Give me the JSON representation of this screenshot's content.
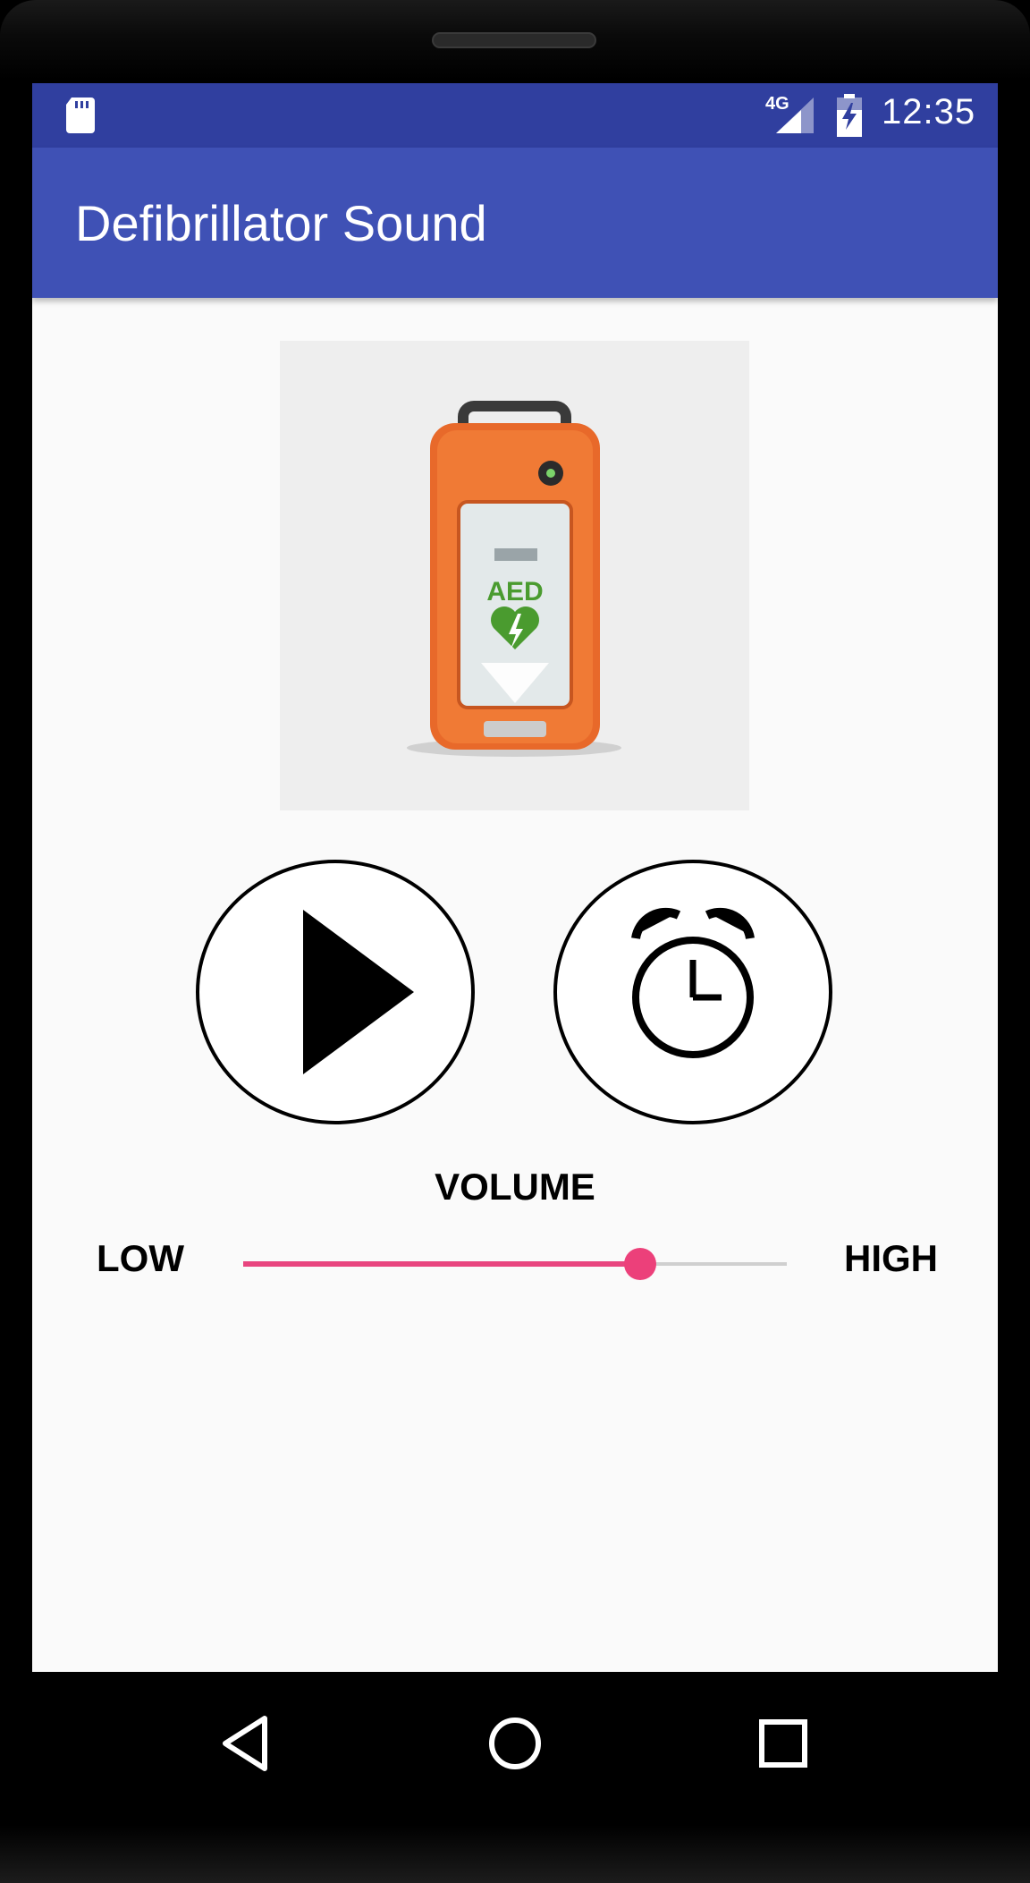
{
  "status_bar": {
    "network": "4G",
    "time": "12:35"
  },
  "app_bar": {
    "title": "Defibrillator Sound"
  },
  "image": {
    "device_text": "AED"
  },
  "controls": {
    "volume_label": "VOLUME",
    "low_label": "LOW",
    "high_label": "HIGH",
    "volume_value": 0.73
  },
  "colors": {
    "status_bar": "#303f9f",
    "app_bar": "#3f51b5",
    "accent": "#ec407a"
  },
  "icons": {
    "play": "play-icon",
    "alarm": "alarm-clock-icon",
    "back": "back-triangle-icon",
    "home": "home-circle-icon",
    "recent": "recent-square-icon"
  }
}
